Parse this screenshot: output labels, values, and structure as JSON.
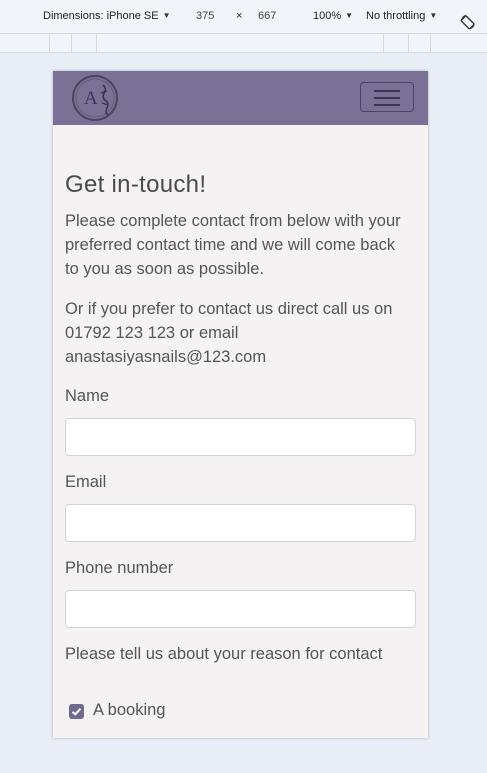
{
  "devtools": {
    "dimensions_label": "Dimensions: iPhone SE",
    "width": "375",
    "times": "×",
    "height": "667",
    "zoom": "100%",
    "throttling": "No throttling",
    "caret_icon": "caret-down-icon",
    "rotate_icon": "rotate-icon"
  },
  "navbar": {
    "logo_icon": "brand-logo",
    "menu_icon": "hamburger-menu-icon",
    "accent_color": "#7a7296"
  },
  "page": {
    "title": "Get in-touch!",
    "intro": "Please complete contact from below with your preferred contact time and we will come back to you as soon as possible.",
    "direct_contact": "Or if you prefer to contact us direct call us on 01792 123 123 or email anastasiyasnails@123.com"
  },
  "form": {
    "name_label": "Name",
    "name_value": "",
    "email_label": "Email",
    "email_value": "",
    "phone_label": "Phone number",
    "phone_value": "",
    "reason_label": "Please tell us about your reason for contact",
    "options": [
      {
        "label": "A booking",
        "checked": true
      }
    ]
  }
}
